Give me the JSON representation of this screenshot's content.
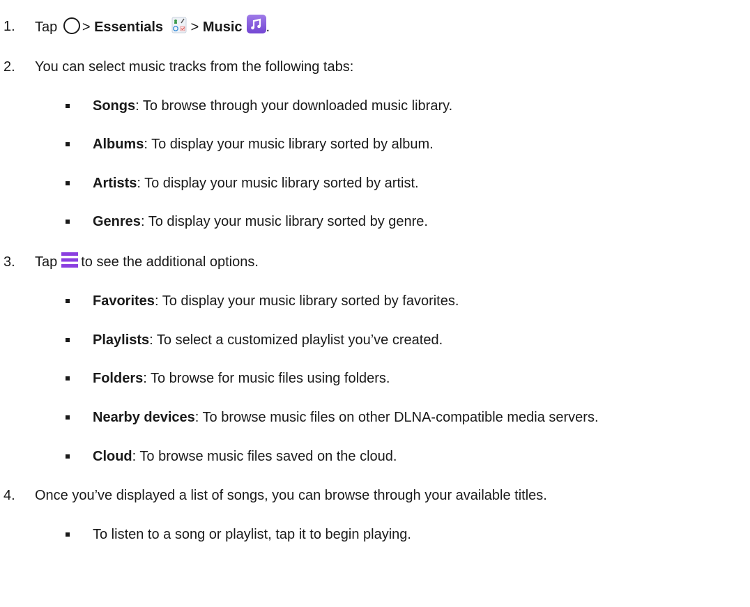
{
  "steps": [
    {
      "number": "1.",
      "tap": "Tap",
      "sep1": ">",
      "essentials": "Essentials",
      "sep2": ">",
      "music": "Music",
      "end": "."
    },
    {
      "number": "2.",
      "text": "You can select music tracks from the following tabs:"
    },
    {
      "number": "3.",
      "tap": "Tap",
      "text": "to see the additional options."
    },
    {
      "number": "4.",
      "text": "Once you’ve displayed a list of songs, you can browse through your available titles."
    }
  ],
  "tabs": [
    {
      "term": "Songs",
      "desc": ": To browse through your downloaded music library."
    },
    {
      "term": "Albums",
      "desc": ": To display your music library sorted by album."
    },
    {
      "term": "Artists",
      "desc": ": To display your music library sorted by artist."
    },
    {
      "term": "Genres",
      "desc": ": To display your music library sorted by genre."
    }
  ],
  "options": [
    {
      "term": "Favorites",
      "desc": ": To display your music library sorted by favorites."
    },
    {
      "term": "Playlists",
      "desc": ": To select a customized playlist you’ve created."
    },
    {
      "term": "Folders",
      "desc": ": To browse for music files using folders."
    },
    {
      "term": "Nearby devices",
      "desc": ": To browse music files on other DLNA-compatible media servers."
    },
    {
      "term": "Cloud",
      "desc": ": To browse music files saved on the cloud."
    }
  ],
  "browse": [
    {
      "desc": "To listen to a song or playlist, tap it to begin playing."
    }
  ],
  "icons": {
    "home": "home-circle-icon",
    "essentials": "essentials-folder-icon",
    "music": "music-note-icon",
    "menu": "menu-icon"
  },
  "colors": {
    "music_icon": "#8a5fe0",
    "menu_icon": "#8b3fe0"
  }
}
